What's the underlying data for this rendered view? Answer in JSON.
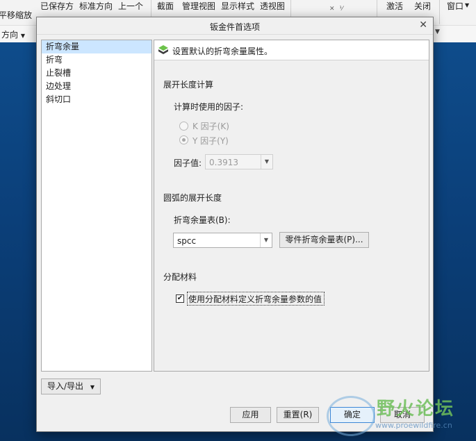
{
  "ribbon": {
    "items": [
      "平移缩放",
      "已保存方",
      "标准方向",
      "上一个",
      "截面",
      "管理视图",
      "显示样式",
      "透视图",
      "激活",
      "关闭",
      "窗口"
    ],
    "direction_label": "方向"
  },
  "dialog": {
    "title": "钣金件首选项",
    "categories": [
      "折弯余量",
      "折弯",
      "止裂槽",
      "边处理",
      "斜切口"
    ],
    "header_text": "设置默认的折弯余量属性。",
    "section1": {
      "title": "展开长度计算",
      "factor_label": "计算时使用的因子:",
      "k_label": "K 因子(K)",
      "y_label": "Y 因子(Y)",
      "factor_value_label": "因子值:",
      "factor_value": "0.3913"
    },
    "section2": {
      "title": "圆弧的展开长度",
      "table_label": "折弯余量表(B):",
      "table_value": "spcc",
      "part_table_button": "零件折弯余量表(P)..."
    },
    "section3": {
      "title": "分配材料",
      "checkbox_label": "使用分配材料定义折弯余量参数的值",
      "checked": true
    },
    "import_export": "导入/导出",
    "buttons": {
      "apply": "应用",
      "reset": "重置(R)",
      "ok": "确定",
      "cancel": "取消"
    }
  },
  "watermark": {
    "text": "野火论坛",
    "url": "www.proewildfire.cn"
  }
}
